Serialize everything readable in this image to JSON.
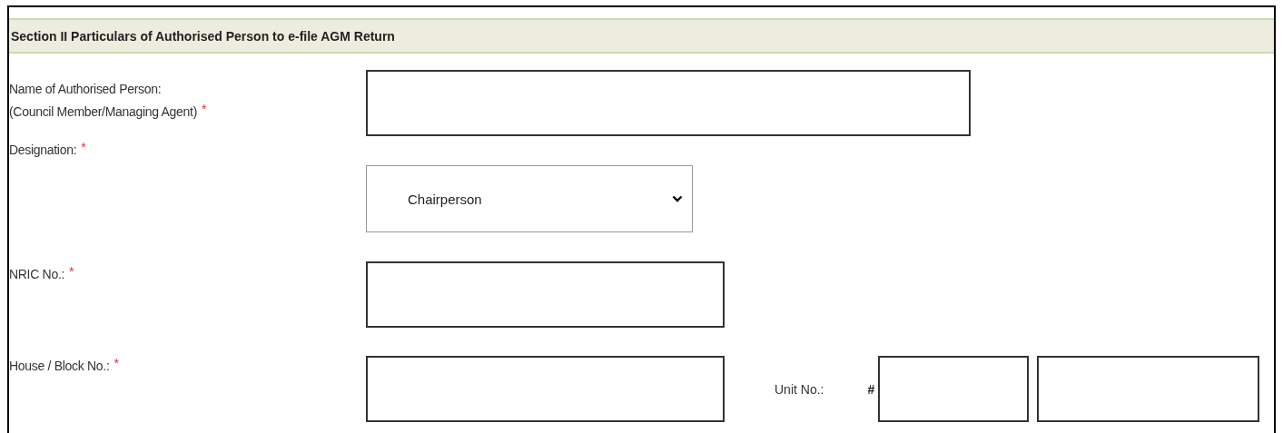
{
  "section_title": "Section II Particulars of Authorised Person to e-file AGM Return",
  "fields": [
    {
      "kind": "text",
      "label_lines": [
        "Name of Authorised Person:",
        "(Council Member/Managing Agent)"
      ],
      "required_mark": "*"
    },
    {
      "kind": "select",
      "label_lines": [
        "Designation:"
      ],
      "required_mark": "*",
      "value": "Chairperson"
    },
    {
      "kind": "text",
      "label_lines": [
        "NRIC No.:"
      ],
      "required_mark": "*"
    },
    {
      "kind": "text",
      "label_lines": [
        "House / Block No.:"
      ],
      "required_mark": "*",
      "unit": {
        "label": "Unit No.:",
        "prefix": "#"
      }
    }
  ]
}
